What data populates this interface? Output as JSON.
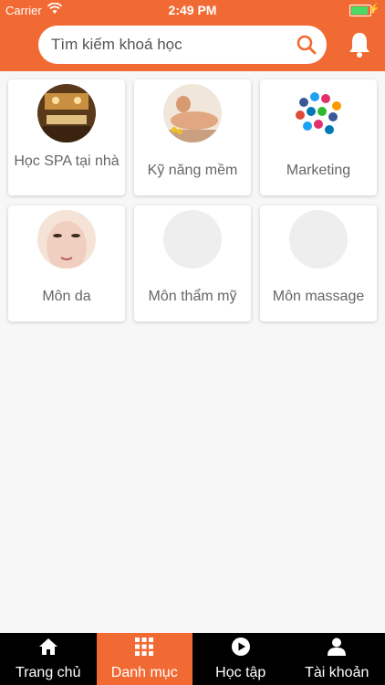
{
  "status_bar": {
    "carrier": "Carrier",
    "time": "2:49 PM"
  },
  "search": {
    "placeholder": "Tìm kiếm khoá học"
  },
  "categories": [
    {
      "label": "Học SPA tại nhà"
    },
    {
      "label": "Kỹ năng mềm"
    },
    {
      "label": "Marketing"
    },
    {
      "label": "Môn da"
    },
    {
      "label": "Môn thẩm mỹ"
    },
    {
      "label": "Môn massage"
    }
  ],
  "tabs": [
    {
      "label": "Trang chủ",
      "icon": "home-icon"
    },
    {
      "label": "Danh mục",
      "icon": "grid-icon",
      "active": true
    },
    {
      "label": "Học tập",
      "icon": "play-icon"
    },
    {
      "label": "Tài khoản",
      "icon": "user-icon"
    }
  ],
  "colors": {
    "accent": "#f26a33",
    "tabbar": "#000000",
    "background": "#f7f7f7"
  }
}
